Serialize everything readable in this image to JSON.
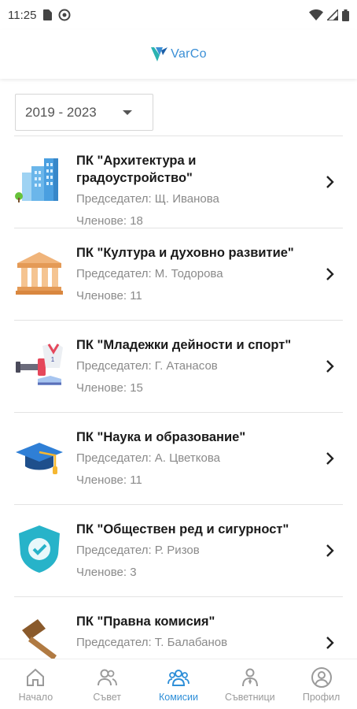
{
  "status_bar": {
    "time": "11:25"
  },
  "header": {
    "logo_text": "VarCo"
  },
  "period_select": {
    "value": "2019 - 2023"
  },
  "commissions": [
    {
      "title": "ПК \"Архитектура и градоустройство\"",
      "chair": "Председател: Щ. Иванова",
      "members": "Членове: 18",
      "icon": "city-buildings-icon"
    },
    {
      "title": "ПК \"Култура и духовно развитие\"",
      "chair": "Председател: М. Тодорова",
      "members": "Членове: 11",
      "icon": "museum-building-icon"
    },
    {
      "title": "ПК \"Младежки дейности и спорт\"",
      "chair": "Председател: Г. Атанасов",
      "members": "Членове: 15",
      "icon": "sports-icon"
    },
    {
      "title": "ПК \"Наука и образование\"",
      "chair": "Председател: А. Цветкова",
      "members": "Членове: 11",
      "icon": "graduation-cap-icon"
    },
    {
      "title": "ПК \"Обществен ред и сигурност\"",
      "chair": "Председател: Р. Ризов",
      "members": "Членове: 3",
      "icon": "shield-check-icon"
    },
    {
      "title": "ПК \"Правна комисия\"",
      "chair": "Председател: Т. Балабанов",
      "members": "",
      "icon": "gavel-icon"
    }
  ],
  "nav": [
    {
      "label": "Начало",
      "icon": "home-icon"
    },
    {
      "label": "Съвет",
      "icon": "group-icon"
    },
    {
      "label": "Комисии",
      "icon": "commissions-icon",
      "active": true
    },
    {
      "label": "Съветници",
      "icon": "councilor-icon"
    },
    {
      "label": "Профил",
      "icon": "profile-icon"
    }
  ],
  "colors": {
    "accent": "#2f8fd8",
    "text_secondary": "#8a8a8a"
  }
}
